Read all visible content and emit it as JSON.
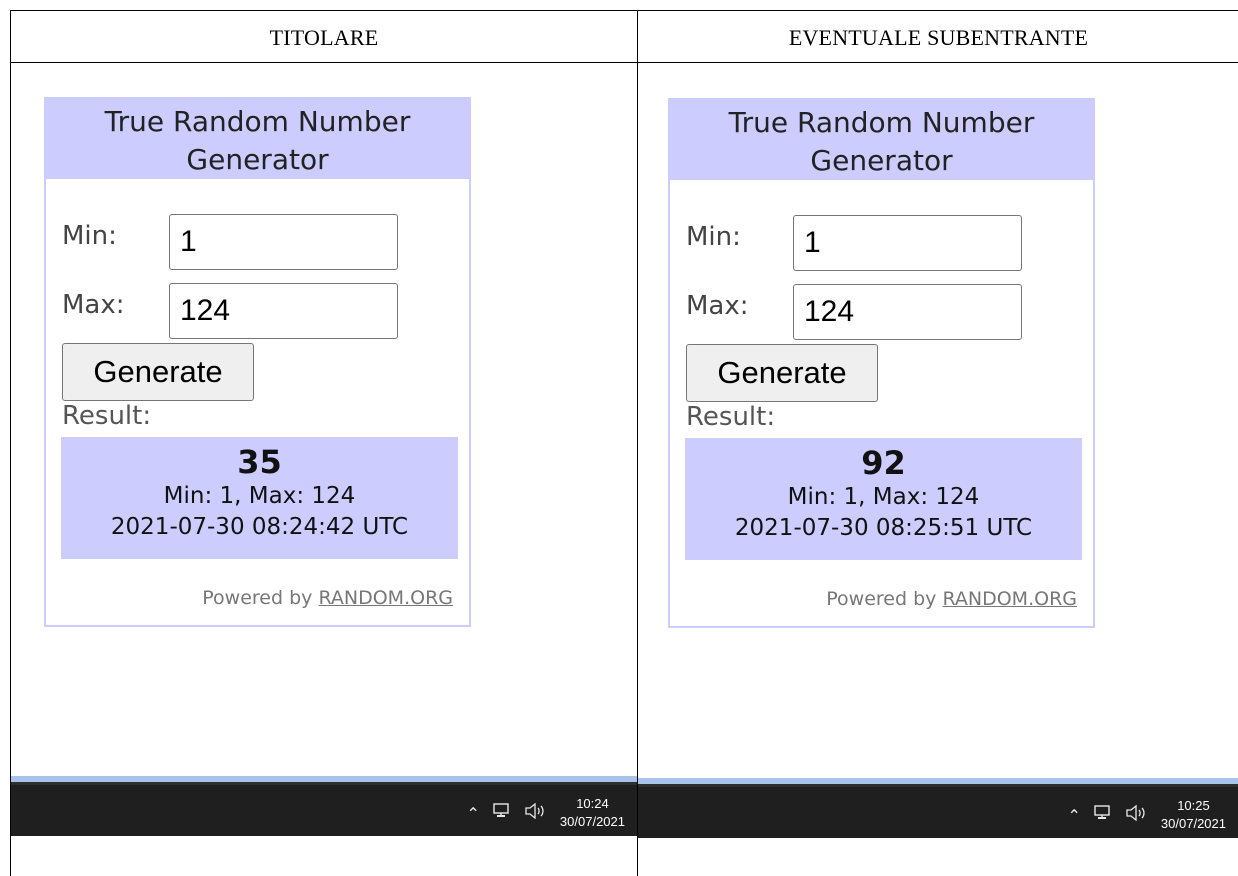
{
  "columns": [
    {
      "header": "TITOLARE",
      "widget": {
        "title_line1": "True Random Number",
        "title_line2": "Generator",
        "min_label": "Min:",
        "min_value": "1",
        "max_label": "Max:",
        "max_value": "124",
        "generate_label": "Generate",
        "result_label": "Result:",
        "result_number": "35",
        "result_range": "Min: 1, Max: 124",
        "result_timestamp": "2021-07-30 08:24:42 UTC",
        "powered_prefix": "Powered by ",
        "powered_link": "RANDOM.ORG"
      },
      "taskbar": {
        "time": "10:24",
        "date": "30/07/2021"
      }
    },
    {
      "header": "EVENTUALE SUBENTRANTE",
      "widget": {
        "title_line1": "True Random Number",
        "title_line2": "Generator",
        "min_label": "Min:",
        "min_value": "1",
        "max_label": "Max:",
        "max_value": "124",
        "generate_label": "Generate",
        "result_label": "Result:",
        "result_number": "92",
        "result_range": "Min: 1, Max: 124",
        "result_timestamp": "2021-07-30 08:25:51 UTC",
        "powered_prefix": "Powered by ",
        "powered_link": "RANDOM.ORG"
      },
      "taskbar": {
        "time": "10:25",
        "date": "30/07/2021"
      }
    }
  ],
  "icons": {
    "tray_chevron": "chevron-up-icon",
    "tray_network": "network-icon",
    "tray_volume": "volume-icon"
  },
  "colors": {
    "widget_accent": "#ccccff",
    "taskbar": "#1f1f1f"
  }
}
